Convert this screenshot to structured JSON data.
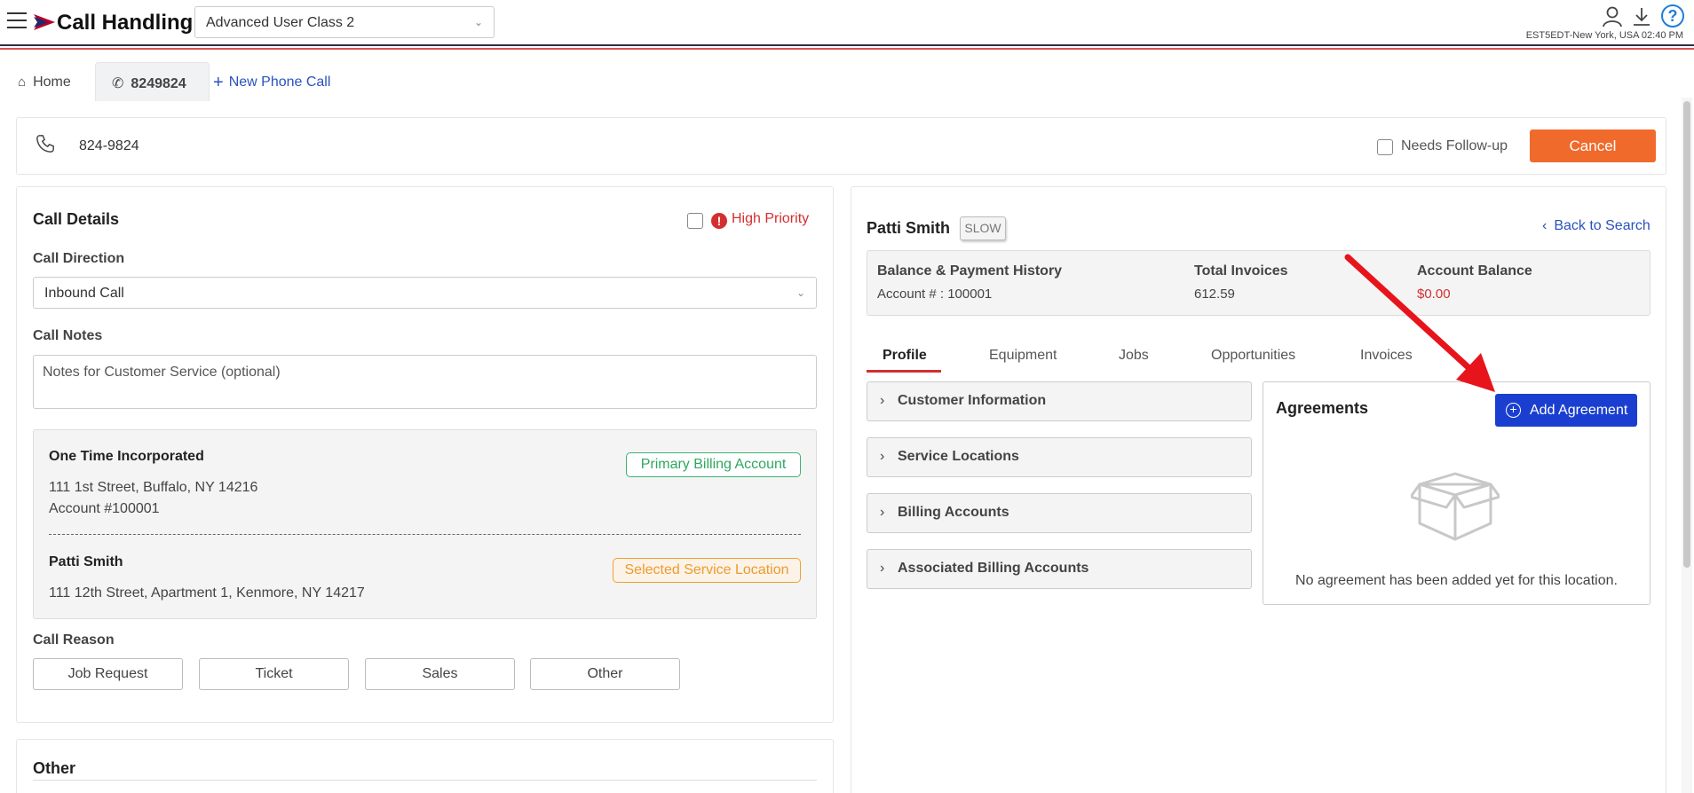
{
  "header": {
    "app_title": "Call Handling",
    "user_class": "Advanced User Class 2",
    "timezone": "EST5EDT-New York, USA 02:40 PM",
    "help_glyph": "?"
  },
  "tabs": {
    "home": "Home",
    "call_tab": "8249824",
    "new_call": "New Phone Call"
  },
  "phone_bar": {
    "number": "824-9824",
    "needs_followup": "Needs Follow-up",
    "cancel": "Cancel"
  },
  "call_details": {
    "title": "Call Details",
    "high_priority": "High Priority",
    "direction_label": "Call Direction",
    "direction_value": "Inbound Call",
    "notes_label": "Call Notes",
    "notes_placeholder": "Notes for Customer Service (optional)",
    "billing": {
      "name": "One Time Incorporated",
      "address": "111 1st Street, Buffalo, NY 14216",
      "account": "Account #100001",
      "badge": "Primary Billing Account"
    },
    "service": {
      "name": "Patti Smith",
      "address": "111 12th Street, Apartment 1, Kenmore, NY 14217",
      "badge": "Selected Service Location"
    },
    "reason_label": "Call Reason",
    "reasons": [
      "Job Request",
      "Ticket",
      "Sales",
      "Other"
    ],
    "other_title": "Other"
  },
  "customer": {
    "name": "Patti Smith",
    "badge": "SLOW",
    "back": "Back to Search",
    "balance": {
      "history_label": "Balance & Payment History",
      "account": "Account # : 100001",
      "invoices_label": "Total Invoices",
      "invoices_value": "612.59",
      "acct_balance_label": "Account Balance",
      "acct_balance_value": "$0.00"
    },
    "tabs": [
      "Profile",
      "Equipment",
      "Jobs",
      "Opportunities",
      "Invoices"
    ],
    "accordions": [
      "Customer Information",
      "Service Locations",
      "Billing Accounts",
      "Associated Billing Accounts"
    ],
    "agreements": {
      "title": "Agreements",
      "add_button": "Add Agreement",
      "empty": "No agreement has been added yet for this location."
    }
  },
  "colors": {
    "accent_blue": "#1a3fd0",
    "cancel_orange": "#f06a2c",
    "priority_red": "#d32f2f",
    "badge_green": "#2ea85e",
    "badge_orange": "#ee9a2c",
    "annotation_arrow": "#e8141c"
  }
}
